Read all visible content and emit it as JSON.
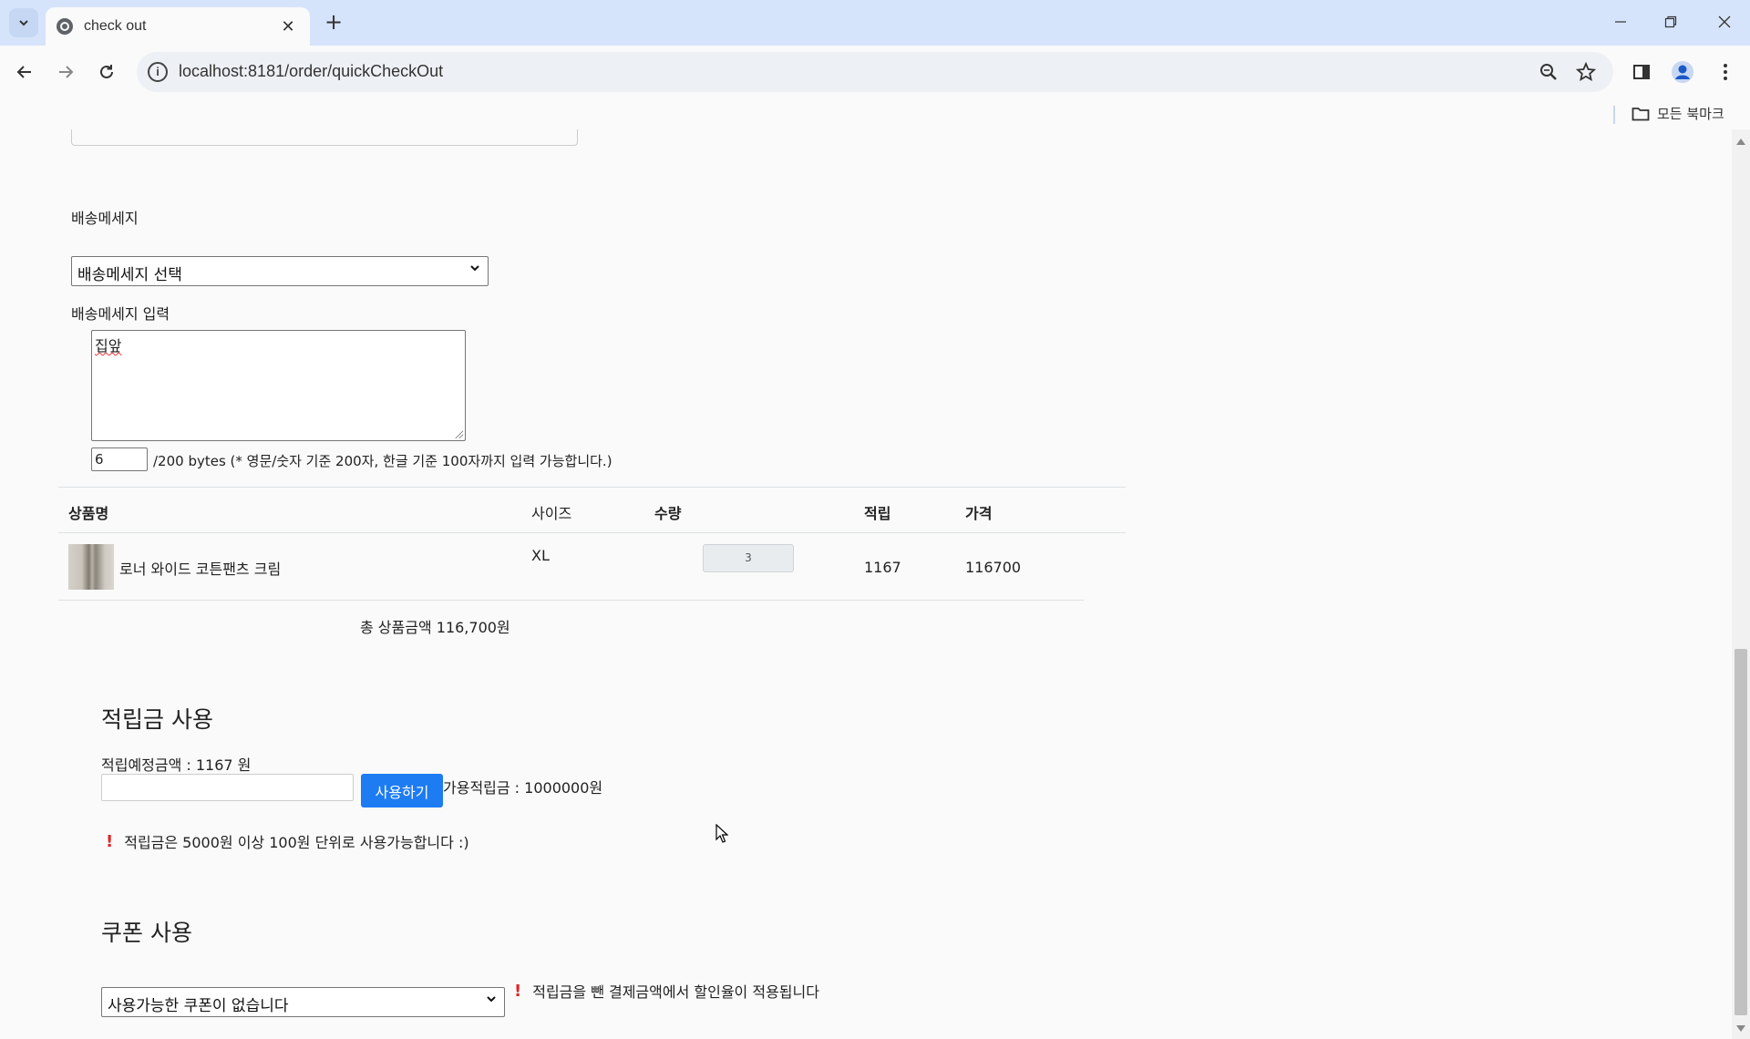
{
  "browser": {
    "tab_title": "check out",
    "url": "localhost:8181/order/quickCheckOut",
    "bookmarks_folder": "모든 북마크"
  },
  "delivery": {
    "label": "배송메세지",
    "select_value": "배송메세지 선택",
    "input_label": "배송메세지 입력",
    "textarea_value": "집앞",
    "byte_count": "6",
    "byte_hint": "/200 bytes (* 영문/숫자 기준 200자, 한글 기준 100자까지 입력 가능합니다.)"
  },
  "order_table": {
    "headers": [
      "상품명",
      "사이즈",
      "수량",
      "적립",
      "가격"
    ],
    "rows": [
      {
        "name": "로너 와이드 코튼팬츠 크림",
        "size": "XL",
        "qty": "3",
        "points": "1167",
        "price": "116700"
      }
    ],
    "total": "총 상품금액 116,700원"
  },
  "points": {
    "title": "적립금 사용",
    "expected": "적립예정금액 : 1167 원",
    "button": "사용하기",
    "available": "가용적립금 : 1000000원",
    "notice": "적립금은 5000원 이상 100원 단위로 사용가능합니다 :)"
  },
  "coupon": {
    "title": "쿠폰 사용",
    "select_value": "사용가능한 쿠폰이 없습니다",
    "notice": "적립금을 뺀 결제금액에서 할인율이 적용됩니다"
  }
}
